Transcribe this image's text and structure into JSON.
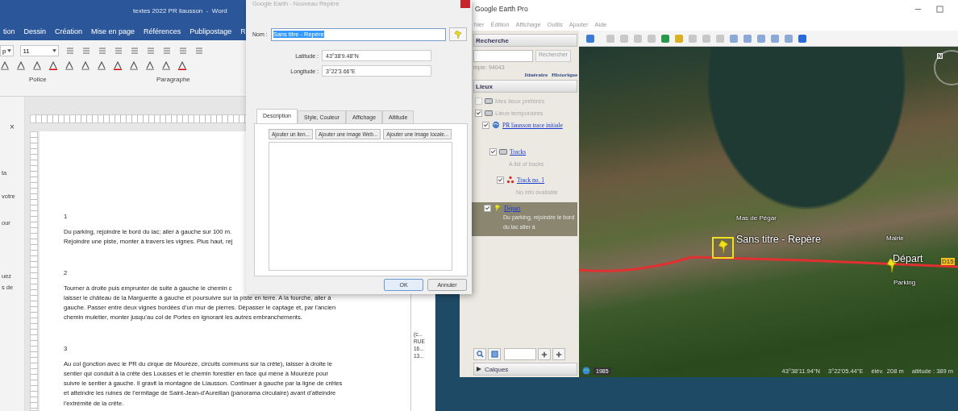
{
  "word": {
    "title": "textes 2022 PR liausson  -  Word",
    "tabs": [
      {
        "label": "tion",
        "selected": false
      },
      {
        "label": "Dessin",
        "selected": false
      },
      {
        "label": "Création",
        "selected": false
      },
      {
        "label": "Mise en page",
        "selected": false
      },
      {
        "label": "Références",
        "selected": false
      },
      {
        "label": "Publipostage",
        "selected": false
      },
      {
        "label": "R",
        "selected": false
      }
    ],
    "font_name": "p",
    "font_size": "11",
    "groups": [
      "Police",
      "Paragraphe"
    ],
    "nav_fragments": [
      "×",
      "ta",
      "votre",
      "our",
      "uez",
      "s de"
    ],
    "paragraphs": [
      {
        "number": "1",
        "lines": [
          "Du parking, rejoindre le bord du lac; aller à gauche sur 100 m.",
          "Rejoindre une piste, monter à travers les vignes. Plus haut, rej"
        ]
      },
      {
        "number": "2",
        "lines": [
          "Tourner à droite puis emprunter de suite à gauche le chemin c",
          "laisser le château de la Marguerite à gauche et poursuivre sur la piste en terre. A la fourche, aller à",
          "gauche. Passer entre deux vignes bordées d’un mur de pierres. Dépasser le captage et, par l’ancien",
          "chemin muletier, monter jusqu’au col de Portes en ignorant les autres embranchements."
        ]
      },
      {
        "number": "3",
        "lines": [
          "Au col (jonction avec le PR du cirque de Mourèze, circuits communs sur la crête), laisser à droite le",
          "sentier qui conduit à la crête des Lousses et le chemin forestier en face qui mène à Mourèze pour",
          "suivre le sentier à gauche. Il gravit la montagne de Liausson. Continuer à gauche par la ligne de crêtes",
          "et atteindre les ruines de l’ermitage de Saint-Jean-d’Aureillan (panorama circulaire) avant d’atteindre",
          "l’extrémité de la crête."
        ]
      }
    ]
  },
  "side_fragments": [
    "(c...",
    "RUE",
    "16...",
    "13..."
  ],
  "dialog": {
    "title": "Google Earth - Nouveau Repère",
    "name_label": "Nom :",
    "name_value": "Sans titre - Repère",
    "lat_label": "Latitude :",
    "lat_value": "43°38'9.48\"N",
    "lon_label": "Longitude :",
    "lon_value": "3°22'3.66\"E",
    "tabs": [
      {
        "label": "Description",
        "selected": true
      },
      {
        "label": "Style, Couleur",
        "selected": false
      },
      {
        "label": "Affichage",
        "selected": false
      },
      {
        "label": "Altitude",
        "selected": false
      }
    ],
    "actions": [
      "Ajouter un lien...",
      "Ajouter une image Web...",
      "Ajouter une image locale..."
    ],
    "buttons": [
      "OK",
      "Annuler"
    ]
  },
  "earth": {
    "title": "Google Earth Pro",
    "menu": [
      "hier",
      "Édition",
      "Affichage",
      "Outils",
      "Ajouter",
      "Aide"
    ],
    "search_header": "Recherche",
    "search_button": "Rechercher",
    "search_hint": "mple: 94043",
    "links": [
      "Itinéraire",
      "Historique"
    ],
    "places_header": "Lieux",
    "places": [
      {
        "label": "Mes lieux préférés",
        "kind": "folder",
        "checked": false,
        "selected": false,
        "link": false
      },
      {
        "label": "Lieux temporaires",
        "kind": "folder",
        "checked": true,
        "selected": false,
        "link": false,
        "children": [
          {
            "label": "PR liausson trace initiale",
            "kind": "network",
            "checked": true,
            "selected": false,
            "link": true,
            "children": [
              {
                "label": "Tracks",
                "kind": "folder",
                "checked": true,
                "selected": false,
                "link": true,
                "description": "A list of tracks",
                "children": [
                  {
                    "label": "Track no. 1",
                    "kind": "track",
                    "checked": true,
                    "selected": false,
                    "link": true,
                    "description": "No info available"
                  }
                ]
              },
              {
                "label": "Départ",
                "kind": "pin",
                "checked": true,
                "selected": true,
                "link": true,
                "description": "Du parking, rejoindre le bord du lac aller à"
              }
            ]
          }
        ]
      }
    ],
    "layers_header": "Calques",
    "map_labels": [
      {
        "text": "Mas de Pégar",
        "kind": "place"
      },
      {
        "text": "Sans titre - Repère",
        "kind": "pin"
      },
      {
        "text": "Mairie",
        "kind": "place"
      },
      {
        "text": "Départ",
        "kind": "pin"
      },
      {
        "text": "D15",
        "kind": "road"
      },
      {
        "text": "Parking",
        "kind": "place"
      }
    ],
    "compass": "N",
    "year": "1985",
    "status": [
      "43°38'11.94\"N",
      "3°22'05.44\"E",
      "élév.  208 m",
      "altitude : 389 m"
    ]
  }
}
